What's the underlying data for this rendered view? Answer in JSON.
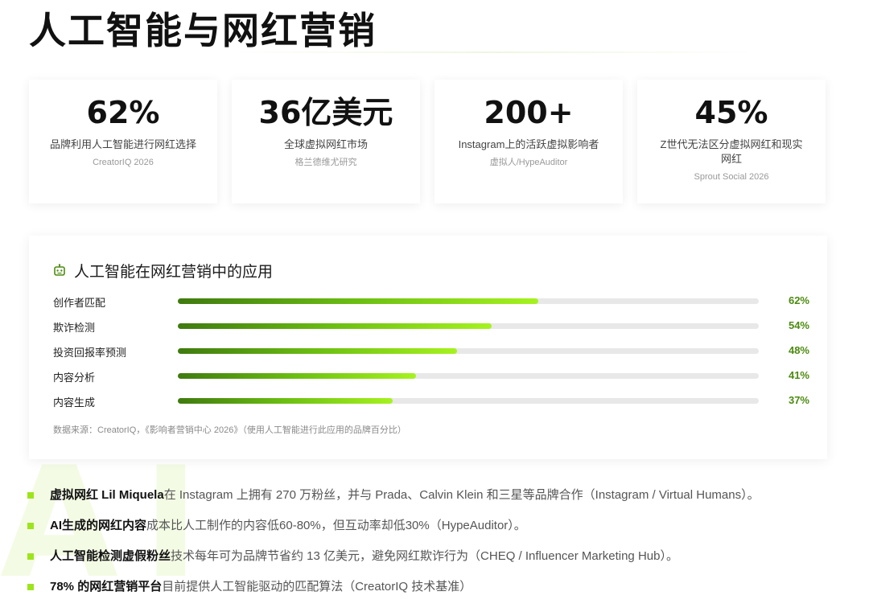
{
  "title": "人工智能与网红营销",
  "watermark": "AI",
  "stats": [
    {
      "value": "62%",
      "label": "品牌利用人工智能进行网红选择",
      "source": "CreatorIQ 2026"
    },
    {
      "value": "36亿美元",
      "label": "全球虚拟网红市场",
      "source": "格兰德维尤研究"
    },
    {
      "value": "200+",
      "label": "Instagram上的活跃虚拟影响者",
      "source": "虚拟人/HypeAuditor"
    },
    {
      "value": "45%",
      "label": "Z世代无法区分虚拟网红和现实网红",
      "source": "Sprout Social 2026"
    }
  ],
  "chart": {
    "title": "人工智能在网红营销中的应用",
    "icon": "robot-icon",
    "note": "数据来源：CreatorIQ，《影响者营销中心 2026》（使用人工智能进行此应用的品牌百分比）"
  },
  "chart_data": {
    "type": "bar",
    "orientation": "horizontal",
    "title": "人工智能在网红营销中的应用",
    "categories": [
      "创作者匹配",
      "欺诈检测",
      "投资回报率预测",
      "内容分析",
      "内容生成"
    ],
    "values": [
      62,
      54,
      48,
      41,
      37
    ],
    "value_labels": [
      "62%",
      "54%",
      "48%",
      "41%",
      "37%"
    ],
    "xlim": [
      0,
      100
    ],
    "unit": "%",
    "grid": false,
    "colors": {
      "fill_start": "#3f7a0f",
      "fill_end": "#a6f21f",
      "track": "#e8e8e8",
      "value_text": "#4d8a10"
    }
  },
  "bullets": [
    {
      "bold": "虚拟网红 Lil Miquela",
      "text": "在 Instagram 上拥有 270 万粉丝，并与 Prada、Calvin Klein 和三星等品牌合作（Instagram / Virtual Humans）。"
    },
    {
      "bold": "AI生成的网红内容",
      "text": "成本比人工制作的内容低60-80%，但互动率却低30%（HypeAuditor）。"
    },
    {
      "bold": "人工智能检测虚假粉丝",
      "text": "技术每年可为品牌节省约 13 亿美元，避免网红欺诈行为（CHEQ / Influencer Marketing Hub）。"
    },
    {
      "bold": "78% 的网红营销平台",
      "text": "目前提供人工智能驱动的匹配算法（CreatorIQ 技术基准）"
    }
  ],
  "colors": {
    "accent": "#9ee41c",
    "accent_dark": "#4d8a10"
  }
}
